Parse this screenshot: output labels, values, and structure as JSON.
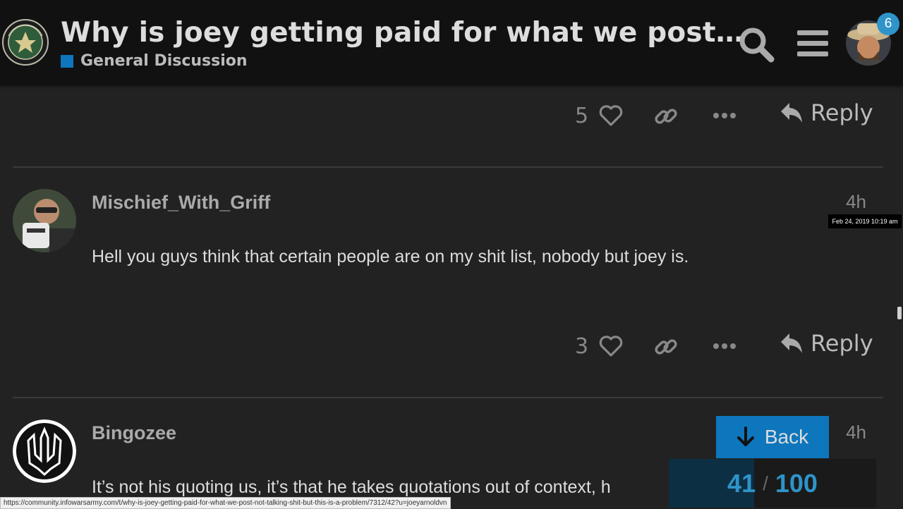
{
  "header": {
    "title": "Why is joey getting paid for what we post…",
    "category": "General Discussion",
    "category_color": "#0E76BD",
    "logo_icon": "infowars-army-seal-icon",
    "search_icon": "search-icon",
    "menu_icon": "hamburger-menu-icon",
    "notification_count": "6"
  },
  "posts": [
    {
      "like_count": "5",
      "reply_label": "Reply"
    },
    {
      "username": "Mischief_With_Griff",
      "time": "4h",
      "time_tooltip": "Feb 24, 2019 10:19 am",
      "text": "Hell you guys think that certain people are on my shit list, nobody but joey is.",
      "like_count": "3",
      "reply_label": "Reply"
    },
    {
      "username": "Bingozee",
      "time": "4h",
      "text": "It’s not his quoting us, it’s that he takes quotations out of context, h"
    }
  ],
  "timeline": {
    "back_label": "Back",
    "current": "41",
    "separator": "/",
    "total": "100",
    "progress": 0.41
  },
  "status_url": "https://community.infowarsarmy.com/t/why-is-joey-getting-paid-for-what-we-post-not-talking-shit-but-this-is-a-problem/7312/42?u=joeyarnoldvn",
  "colors": {
    "background": "#222222",
    "header": "#111111",
    "accent": "#0E76BD",
    "badge": "#2E94C9"
  }
}
